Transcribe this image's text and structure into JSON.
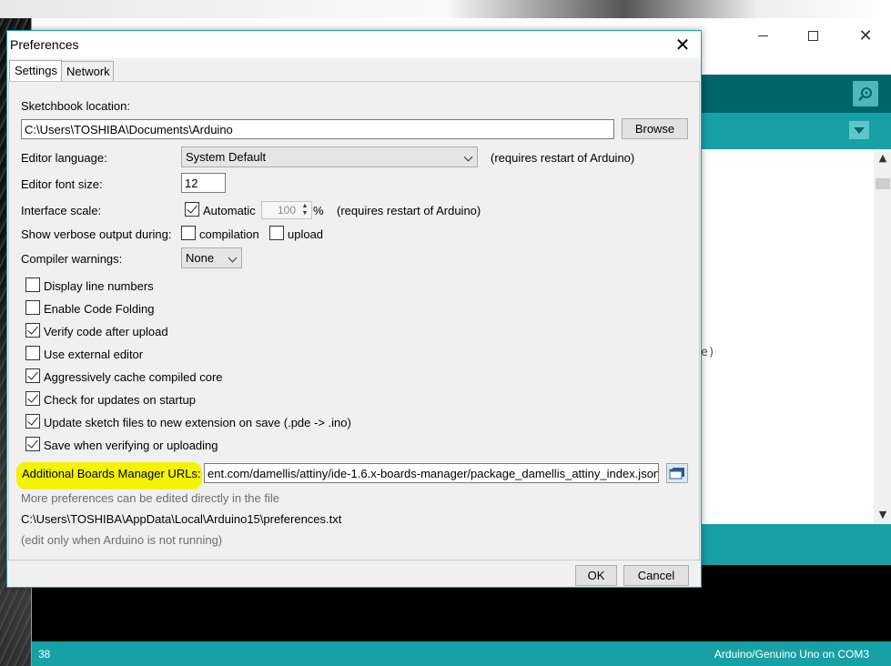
{
  "ide": {
    "editor_fragment": "e)",
    "footer": {
      "line_number": "38",
      "board": "Arduino/Genuino Uno on COM3"
    },
    "icons": {
      "serial_monitor": "magnifier-icon",
      "tab_menu": "chevron-down-icon"
    }
  },
  "dialog": {
    "title": "Preferences",
    "tabs": [
      {
        "label": "Settings",
        "active": true
      },
      {
        "label": "Network",
        "active": false
      }
    ],
    "sketchbook": {
      "label": "Sketchbook location:",
      "value": "C:\\Users\\TOSHIBA\\Documents\\Arduino",
      "browse_label": "Browse"
    },
    "editor_language": {
      "label": "Editor language:",
      "value": "System Default",
      "note": "(requires restart of Arduino)"
    },
    "editor_font_size": {
      "label": "Editor font size:",
      "value": "12"
    },
    "interface_scale": {
      "label": "Interface scale:",
      "automatic_label": "Automatic",
      "automatic_checked": true,
      "value": "100",
      "unit": "%",
      "note": "(requires restart of Arduino)"
    },
    "verbose": {
      "label": "Show verbose output during:",
      "compilation_label": "compilation",
      "compilation_checked": false,
      "upload_label": "upload",
      "upload_checked": false
    },
    "compiler_warnings": {
      "label": "Compiler warnings:",
      "value": "None"
    },
    "options": [
      {
        "label": "Display line numbers",
        "checked": false
      },
      {
        "label": "Enable Code Folding",
        "checked": false
      },
      {
        "label": "Verify code after upload",
        "checked": true
      },
      {
        "label": "Use external editor",
        "checked": false
      },
      {
        "label": "Aggressively cache compiled core",
        "checked": true
      },
      {
        "label": "Check for updates on startup",
        "checked": true
      },
      {
        "label": "Update sketch files to new extension on save (.pde -> .ino)",
        "checked": true
      },
      {
        "label": "Save when verifying or uploading",
        "checked": true
      }
    ],
    "boards_manager": {
      "label": "Additional Boards Manager URLs:",
      "value": "ent.com/damellis/attiny/ide-1.6.x-boards-manager/package_damellis_attiny_index.json",
      "highlight_color": "#f4f400"
    },
    "more_prefs": "More preferences can be edited directly in the file",
    "prefs_path": "C:\\Users\\TOSHIBA\\AppData\\Local\\Arduino15\\preferences.txt",
    "edit_note": "(edit only when Arduino is not running)",
    "ok_label": "OK",
    "cancel_label": "Cancel"
  },
  "colors": {
    "ide_dark_teal": "#006468",
    "ide_teal": "#17a1a5",
    "highlight": "#f4f400"
  }
}
